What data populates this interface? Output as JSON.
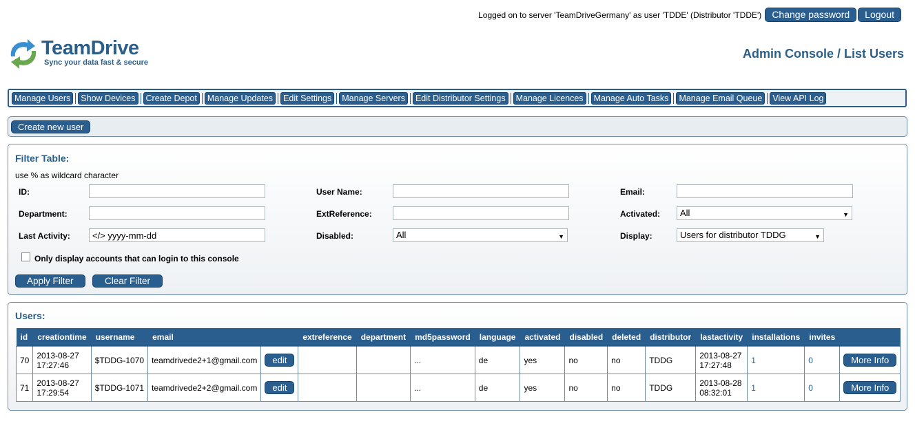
{
  "header": {
    "login_text": "Logged on to server 'TeamDriveGermany' as user 'TDDE' (Distributor 'TDDE')",
    "change_password": "Change password",
    "logout": "Logout",
    "page_title": "Admin Console / List Users"
  },
  "logo": {
    "brand": "TeamDrive",
    "tagline": "Sync your data fast & secure"
  },
  "nav": [
    "Manage Users",
    "Show Devices",
    "Create Depot",
    "Manage Updates",
    "Edit Settings",
    "Manage Servers",
    "Edit Distributor Settings",
    "Manage Licences",
    "Manage Auto Tasks",
    "Manage Email Queue",
    "View API Log"
  ],
  "actions": {
    "create_user": "Create new user"
  },
  "filter": {
    "title": "Filter Table:",
    "hint": "use % as wildcard character",
    "id_label": "ID:",
    "username_label": "User Name:",
    "email_label": "Email:",
    "department_label": "Department:",
    "extreference_label": "ExtReference:",
    "activated_label": "Activated:",
    "activated_value": "All",
    "last_activity_label": "Last Activity:",
    "last_activity_value": "</> yyyy-mm-dd",
    "disabled_label": "Disabled:",
    "disabled_value": "All",
    "display_label": "Display:",
    "display_value": "Users for distributor TDDG",
    "only_login_label": "Only display accounts that can login to this console",
    "apply": "Apply Filter",
    "clear": "Clear Filter"
  },
  "users": {
    "title": "Users:",
    "columns": [
      "id",
      "creationtime",
      "username",
      "email",
      "",
      "extreference",
      "department",
      "md5password",
      "language",
      "activated",
      "disabled",
      "deleted",
      "distributor",
      "lastactivity",
      "installations",
      "invites",
      ""
    ],
    "edit_label": "edit",
    "more_info_label": "More Info",
    "rows": [
      {
        "id": "70",
        "creation_date": "2013-08-27",
        "creation_time": "17:27:46",
        "username": "$TDDG-1070",
        "email": "teamdrivede2+1@gmail.com",
        "extreference": "",
        "department": "",
        "md5password": "...",
        "language": "de",
        "activated": "yes",
        "disabled": "no",
        "deleted": "no",
        "distributor": "TDDG",
        "last_date": "2013-08-27",
        "last_time": "17:27:48",
        "installations": "1",
        "invites": "0"
      },
      {
        "id": "71",
        "creation_date": "2013-08-27",
        "creation_time": "17:29:54",
        "username": "$TDDG-1071",
        "email": "teamdrivede2+2@gmail.com",
        "extreference": "",
        "department": "",
        "md5password": "...",
        "language": "de",
        "activated": "yes",
        "disabled": "no",
        "deleted": "no",
        "distributor": "TDDG",
        "last_date": "2013-08-28",
        "last_time": "08:32:01",
        "installations": "1",
        "invites": "0"
      }
    ]
  },
  "colors": {
    "accent": "#2a5e8f",
    "border": "#6d8ca8",
    "logo_green": "#6aa84f",
    "logo_blue": "#3a8fd0"
  }
}
